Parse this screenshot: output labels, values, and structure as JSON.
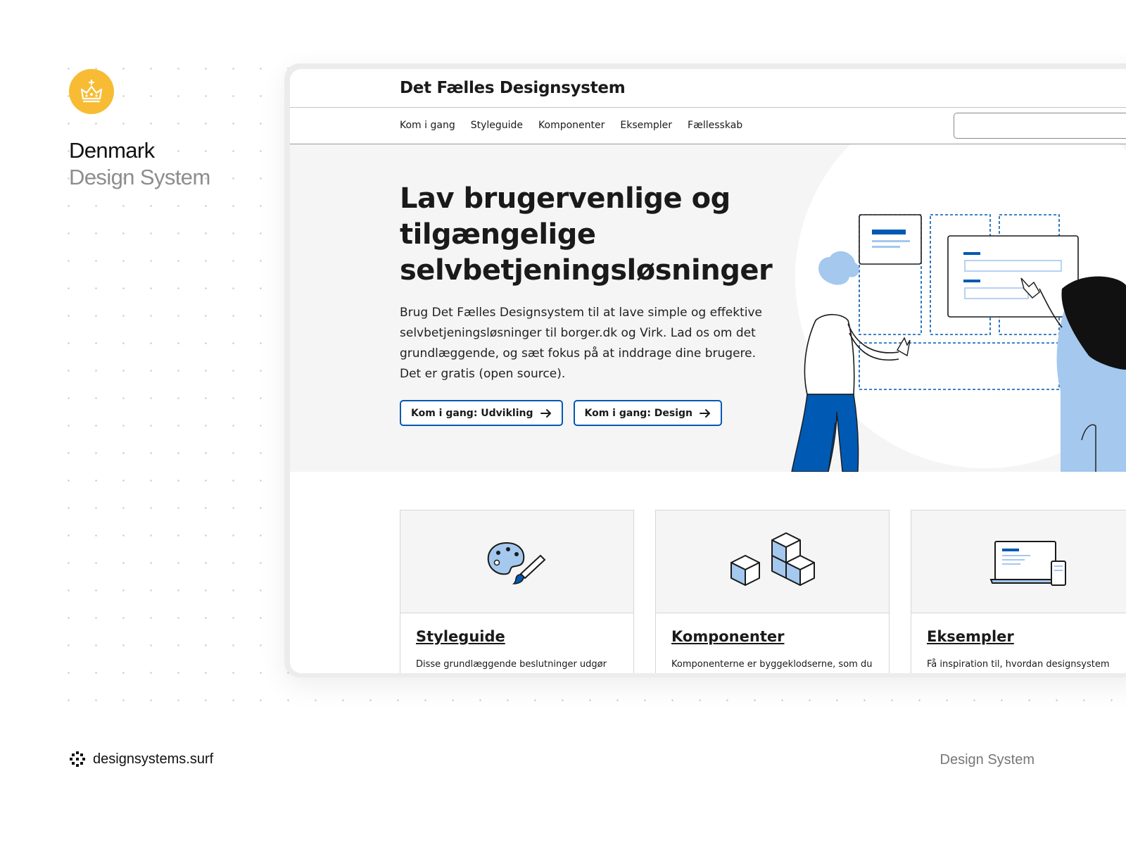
{
  "brand": {
    "name": "Denmark",
    "subtitle": "Design System",
    "logo_icon": "crown-icon",
    "logo_color": "#f7bc33"
  },
  "footer": {
    "site": "designsystems.surf",
    "site_icon": "designsystems-logo-icon",
    "category": "Design System"
  },
  "site": {
    "title": "Det Fælles Designsystem",
    "nav": [
      "Kom i gang",
      "Styleguide",
      "Komponenter",
      "Eksempler",
      "Fællesskab"
    ],
    "search": {
      "value": "",
      "placeholder": ""
    }
  },
  "hero": {
    "title": "Lav brugervenlige og tilgængelige selvbetjeningsløsninger",
    "text": "Brug Det Fælles Designsystem til at lave simple og effektive selvbetjeningsløsninger til borger.dk og Virk. Lad os om det grundlæggende, og sæt fokus på at inddrage dine brugere. Det er gratis (open source).",
    "buttons": [
      {
        "label": "Kom i gang: Udvikling",
        "icon": "arrow-right-icon"
      },
      {
        "label": "Kom i gang: Design",
        "icon": "arrow-right-icon"
      }
    ]
  },
  "cards": [
    {
      "title": "Styleguide",
      "desc": "Disse grundlæggende beslutninger udgør",
      "icon": "palette-brush-icon"
    },
    {
      "title": "Komponenter",
      "desc": "Komponenterne er byggeklodserne, som du",
      "icon": "cubes-icon"
    },
    {
      "title": "Eksempler",
      "desc": "Få inspiration til, hvordan designsystem",
      "icon": "laptop-phone-icon"
    }
  ],
  "colors": {
    "primary": "#0059b3",
    "illustration_light_blue": "#a4c8ee",
    "hero_background": "#f5f5f5"
  }
}
